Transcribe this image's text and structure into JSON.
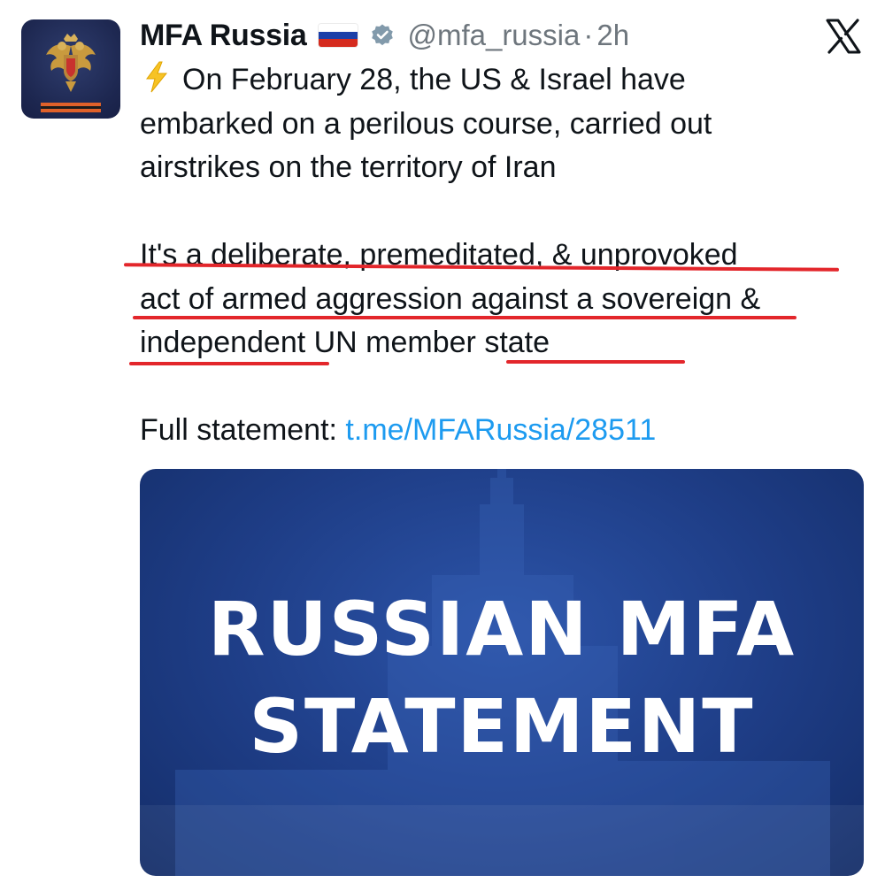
{
  "tweet": {
    "author": {
      "display_name": "MFA Russia",
      "flag": "🇷🇺",
      "verified": true,
      "handle": "@mfa_russia",
      "separator": "·",
      "time": "2h"
    },
    "platform_icon": "x-logo-icon",
    "text": {
      "emoji": "⚡️",
      "line1": "On February 28, the US & Israel have",
      "line2": "embarked on a perilous course, carried out",
      "line3": "airstrikes on the territory of Iran",
      "line4": "It's a deliberate, premeditated, & unprovoked",
      "line5": "act of armed aggression against a sovereign &",
      "line6": "independent UN member state",
      "link_prefix": "Full statement: ",
      "link_text": "t.me/MFARussia/28511"
    },
    "media": {
      "title_line1": "RUSSIAN MFA",
      "title_line2": "STATEMENT"
    },
    "colors": {
      "link": "#1d9bf0",
      "underline": "#e3262b",
      "media_bg": "#1e3d86"
    }
  }
}
